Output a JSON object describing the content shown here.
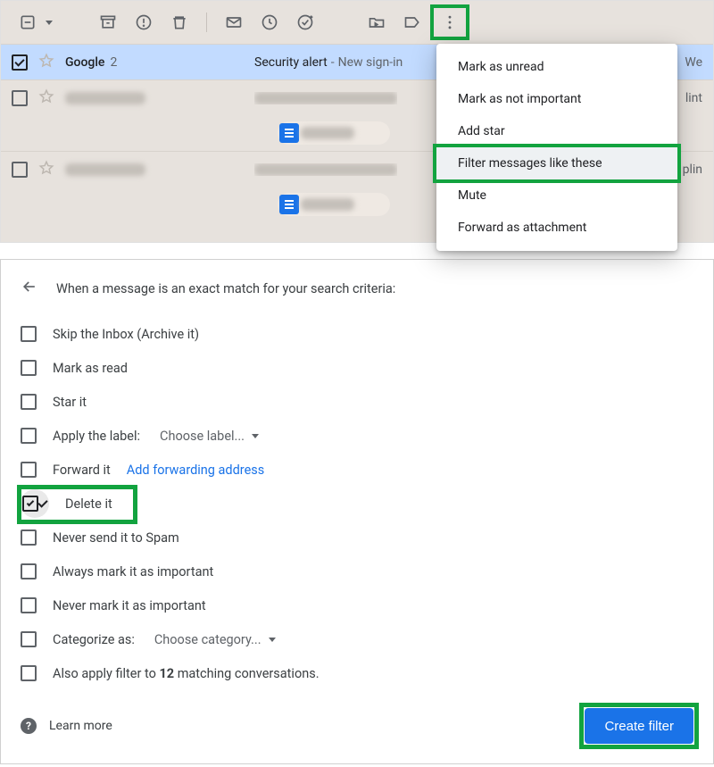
{
  "toolbar": {
    "select": "select-checkbox",
    "archive": "archive",
    "spam": "report-spam",
    "delete": "delete",
    "unread": "mark-unread",
    "snooze": "snooze",
    "addtask": "add-to-tasks",
    "moveto": "move-to",
    "labels": "labels",
    "more": "more"
  },
  "rows": [
    {
      "sender": "Google",
      "count": "2",
      "subject": "Security alert",
      "snippet": "New sign-in ",
      "tail": "We"
    },
    {
      "tail": "lint"
    },
    {
      "tail": "plin"
    }
  ],
  "menu": {
    "items": [
      "Mark as unread",
      "Mark as not important",
      "Add star",
      "Filter messages like these",
      "Mute",
      "Forward as attachment"
    ]
  },
  "filter": {
    "heading": "When a message is an exact match for your search criteria:",
    "opts": {
      "skip": "Skip the Inbox (Archive it)",
      "read": "Mark as read",
      "star": "Star it",
      "label_pre": "Apply the label:",
      "label_dd": "Choose label...",
      "forward": "Forward it",
      "forward_link": "Add forwarding address",
      "delete": "Delete it",
      "never_spam": "Never send it to Spam",
      "always_imp": "Always mark it as important",
      "never_imp": "Never mark it as important",
      "categorize_pre": "Categorize as:",
      "categorize_dd": "Choose category...",
      "also_pre": "Also apply filter to ",
      "also_num": "12",
      "also_post": " matching conversations."
    },
    "learn": "Learn more",
    "create": "Create filter"
  }
}
